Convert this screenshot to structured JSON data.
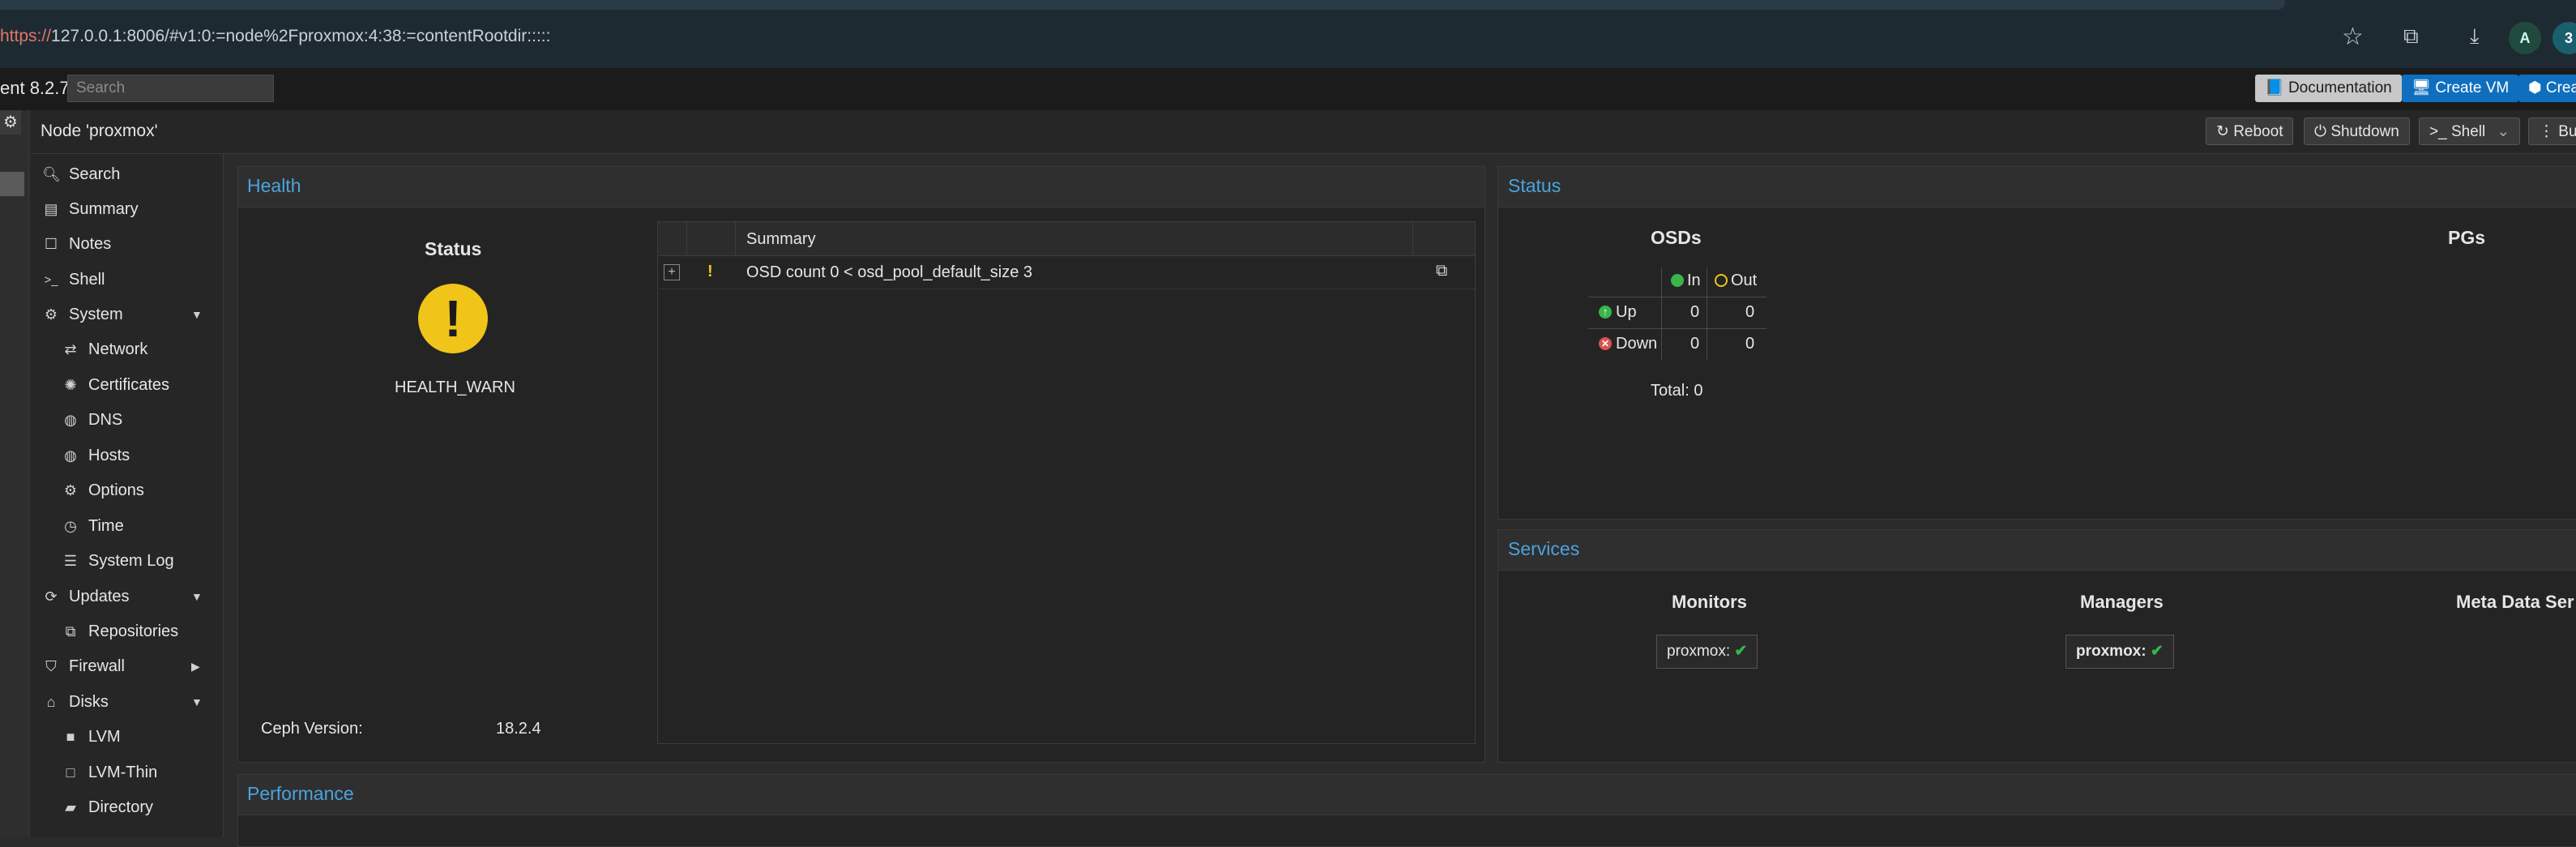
{
  "browser": {
    "url_scheme": "https://",
    "url_rest": "127.0.0.1:8006/#v1:0:=node%2Fproxmox:4:38:=contentRootdir:::::",
    "profile_initial": "A",
    "profile2_initial": "3"
  },
  "header": {
    "version": "ent 8.2.7",
    "search_placeholder": "Search",
    "documentation_label": "Documentation",
    "create_vm_label": "Create VM",
    "create_ct_label": "Crea"
  },
  "node": {
    "title": "Node 'proxmox'",
    "reboot_label": "Reboot",
    "shutdown_label": "Shutdown",
    "shell_label": "Shell",
    "bulk_label": "Bu"
  },
  "nav": {
    "items": [
      {
        "label": "Search",
        "icon": "search-icon"
      },
      {
        "label": "Summary",
        "icon": "book-icon"
      },
      {
        "label": "Notes",
        "icon": "notes-icon"
      },
      {
        "label": "Shell",
        "icon": "terminal-icon"
      },
      {
        "label": "System",
        "icon": "cogs-icon"
      },
      {
        "label": "Network",
        "icon": "exchange-icon"
      },
      {
        "label": "Certificates",
        "icon": "certificate-icon"
      },
      {
        "label": "DNS",
        "icon": "globe-icon"
      },
      {
        "label": "Hosts",
        "icon": "globe-icon"
      },
      {
        "label": "Options",
        "icon": "gear-icon"
      },
      {
        "label": "Time",
        "icon": "clock-icon"
      },
      {
        "label": "System Log",
        "icon": "list-icon"
      },
      {
        "label": "Updates",
        "icon": "refresh-icon"
      },
      {
        "label": "Repositories",
        "icon": "files-icon"
      },
      {
        "label": "Firewall",
        "icon": "shield-icon"
      },
      {
        "label": "Disks",
        "icon": "hdd-icon"
      },
      {
        "label": "LVM",
        "icon": "square-icon"
      },
      {
        "label": "LVM-Thin",
        "icon": "square-outline-icon"
      },
      {
        "label": "Directory",
        "icon": "folder-icon"
      }
    ]
  },
  "health": {
    "title": "Health",
    "status_heading": "Status",
    "status_value": "HEALTH_WARN",
    "ceph_version_label": "Ceph Version:",
    "ceph_version_value": "18.2.4",
    "summary_header": "Summary",
    "warnings": [
      {
        "text": "OSD count 0 < osd_pool_default_size 3",
        "severity": "!"
      }
    ]
  },
  "status": {
    "title": "Status",
    "osds_heading": "OSDs",
    "pgs_heading": "PGs",
    "in_label": "In",
    "out_label": "Out",
    "up_label": "Up",
    "down_label": "Down",
    "up_in": "0",
    "up_out": "0",
    "down_in": "0",
    "down_out": "0",
    "total": "Total: 0"
  },
  "services": {
    "title": "Services",
    "monitors_heading": "Monitors",
    "managers_heading": "Managers",
    "mds_heading": "Meta Data Ser",
    "monitor_host": "proxmox:",
    "manager_host": "proxmox:"
  },
  "performance": {
    "title": "Performance"
  },
  "colors": {
    "accent_blue": "#4aa3df",
    "button_blue": "#0f6fbe",
    "warn_yellow": "#f0c419",
    "ok_green": "#3ab54a",
    "error_red": "#d9534f"
  }
}
